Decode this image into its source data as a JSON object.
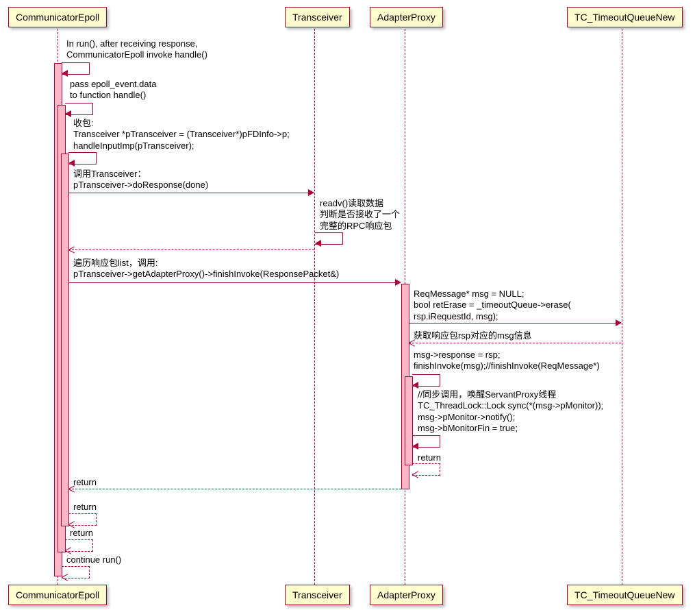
{
  "participants": {
    "p1": "CommunicatorEpoll",
    "p2": "Transceiver",
    "p3": "AdapterProxy",
    "p4": "TC_TimeoutQueueNew"
  },
  "messages": {
    "m1": "In run(), after receiving response,\nCommunicatorEpoll invoke handle()",
    "m2": "pass epoll_event.data\nto function handle()",
    "m3": "收包:\nTransceiver *pTransceiver = (Transceiver*)pFDInfo->p;\nhandleInputImp(pTransceiver);",
    "m4": "调用Transceiver：\npTransceiver->doResponse(done)",
    "m5": "readv()读取数据\n判断是否接收了一个\n完整的RPC响应包",
    "m6": "遍历响应包list，调用:\npTransceiver->getAdapterProxy()->finishInvoke(ResponsePacket&)",
    "m7": "ReqMessage* msg = NULL;\nbool retErase = _timeoutQueue->erase(\nrsp.iRequestId, msg);",
    "m8": "获取响应包rsp对应的msg信息",
    "m9": "msg->response = rsp;\nfinishInvoke(msg);//finishInvoke(ReqMessage*)",
    "m10": "//同步调用，唤醒ServantProxy线程\nTC_ThreadLock::Lock sync(*(msg->pMonitor));\nmsg->pMonitor->notify();\nmsg->bMonitorFin = true;",
    "m11": "return",
    "m12": "return",
    "m13": "return",
    "m14": "return",
    "m15": "continue run()"
  },
  "colors": {
    "border": "#a80036",
    "fill": "#fefece",
    "activation": "#fdb6c6"
  }
}
